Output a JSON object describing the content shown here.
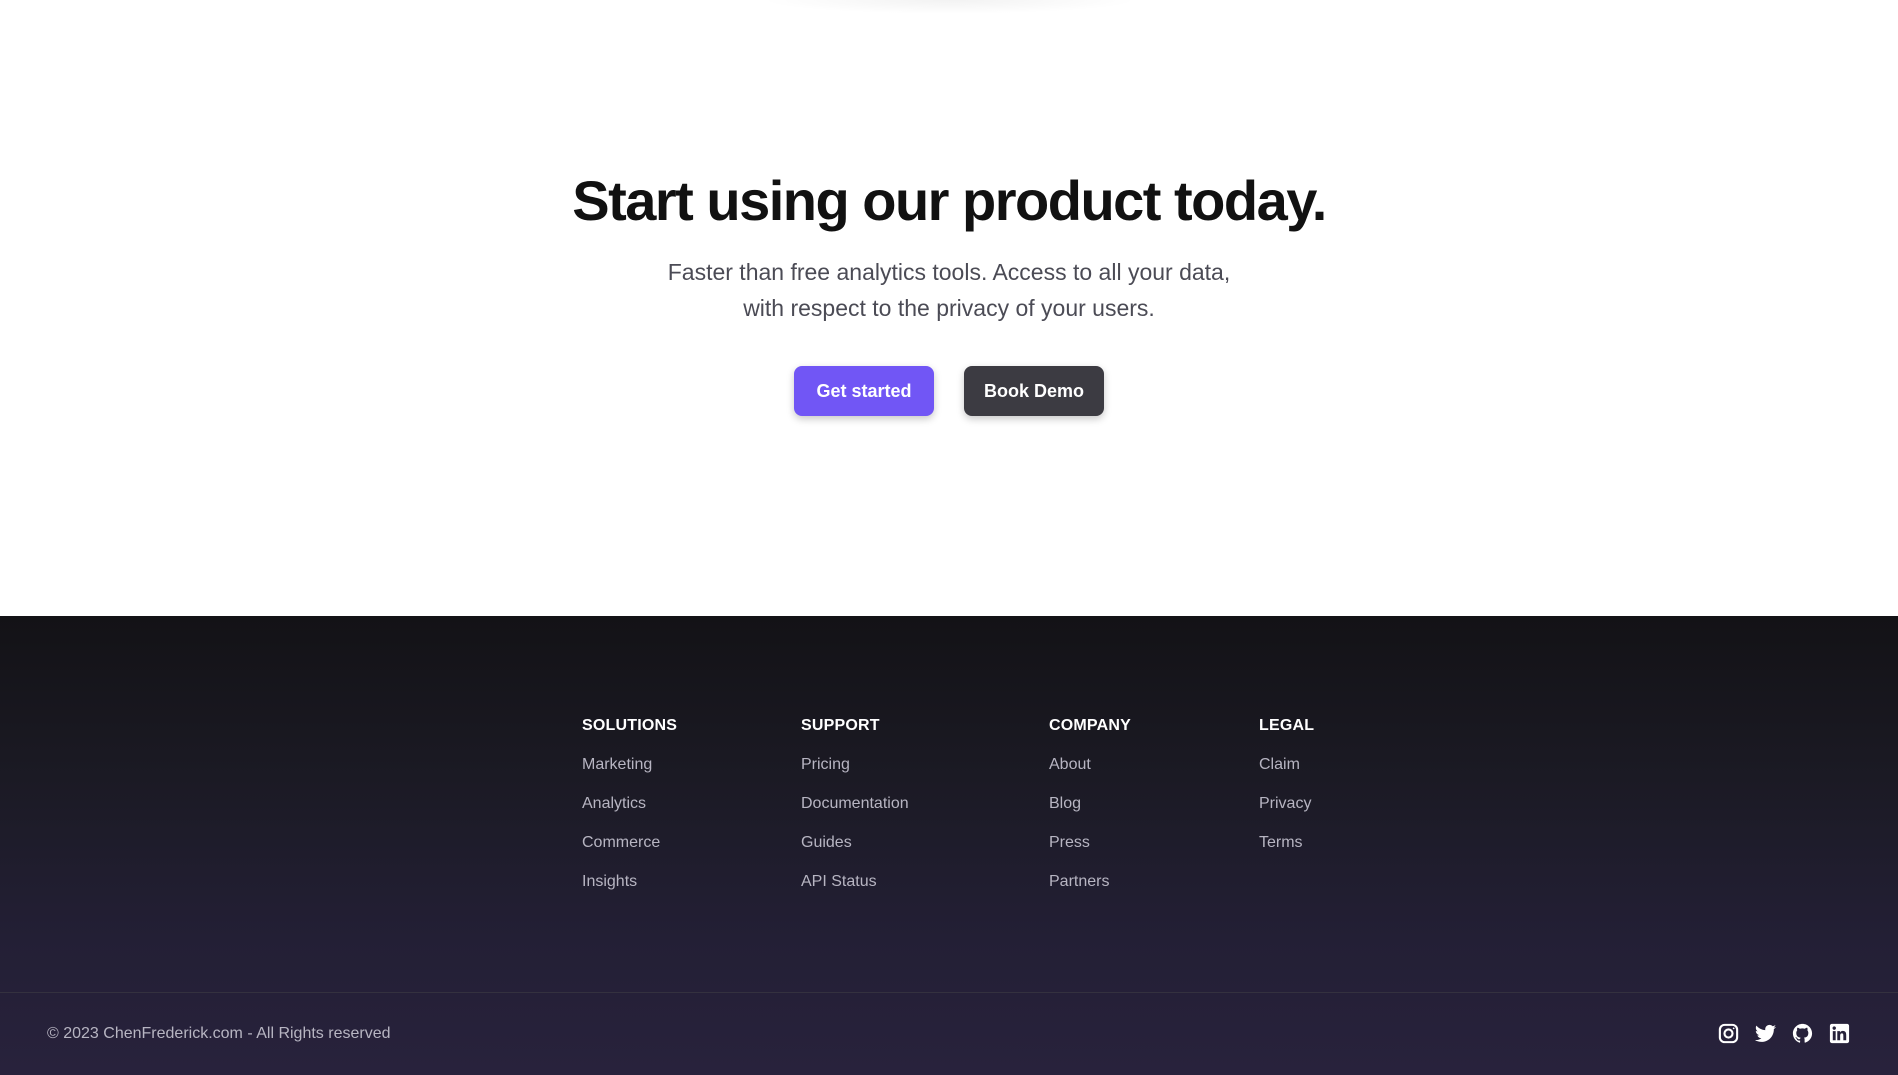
{
  "hero": {
    "title": "Start using our product today.",
    "subtitle_line1": "Faster than free analytics tools. Access to all your data,",
    "subtitle_line2": "with respect to the privacy of your users.",
    "primary_button": "Get started",
    "secondary_button": "Book Demo"
  },
  "footer": {
    "columns": [
      {
        "heading": "SOLUTIONS",
        "links": [
          "Marketing",
          "Analytics",
          "Commerce",
          "Insights"
        ]
      },
      {
        "heading": "SUPPORT",
        "links": [
          "Pricing",
          "Documentation",
          "Guides",
          "API Status"
        ]
      },
      {
        "heading": "COMPANY",
        "links": [
          "About",
          "Blog",
          "Press",
          "Partners"
        ]
      },
      {
        "heading": "LEGAL",
        "links": [
          "Claim",
          "Privacy",
          "Terms"
        ]
      }
    ],
    "copyright": "© 2023 ChenFrederick.com - All Rights reserved",
    "social_icons": [
      "instagram-icon",
      "twitter-icon",
      "github-icon",
      "linkedin-icon"
    ]
  },
  "colors": {
    "accent": "#7156f5",
    "dark_button": "#3c3b42",
    "footer_bg_top": "#131216",
    "footer_bg_bottom": "#28223c",
    "heading_text": "#111111",
    "footer_link": "#b7b5c2"
  }
}
